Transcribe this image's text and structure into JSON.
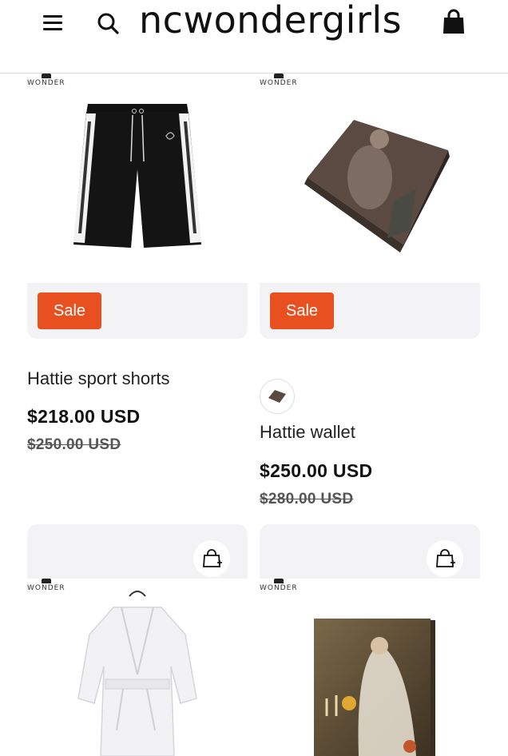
{
  "header": {
    "brand": "ncwondergirls",
    "menu_icon": "hamburger-menu-icon",
    "search_icon": "search-icon",
    "cart_icon": "shopping-bag-icon"
  },
  "brand_mark": "WONDER",
  "products": [
    {
      "title": "Hattie sport shorts",
      "price": "$218.00 USD",
      "compare_price": "$250.00 USD",
      "badge": "Sale"
    },
    {
      "title": "Hattie wallet",
      "price": "$250.00 USD",
      "compare_price": "$280.00 USD",
      "badge": "Sale"
    }
  ],
  "colors": {
    "sale_badge": "#e8511f",
    "card_background": "#f3f3f5"
  }
}
